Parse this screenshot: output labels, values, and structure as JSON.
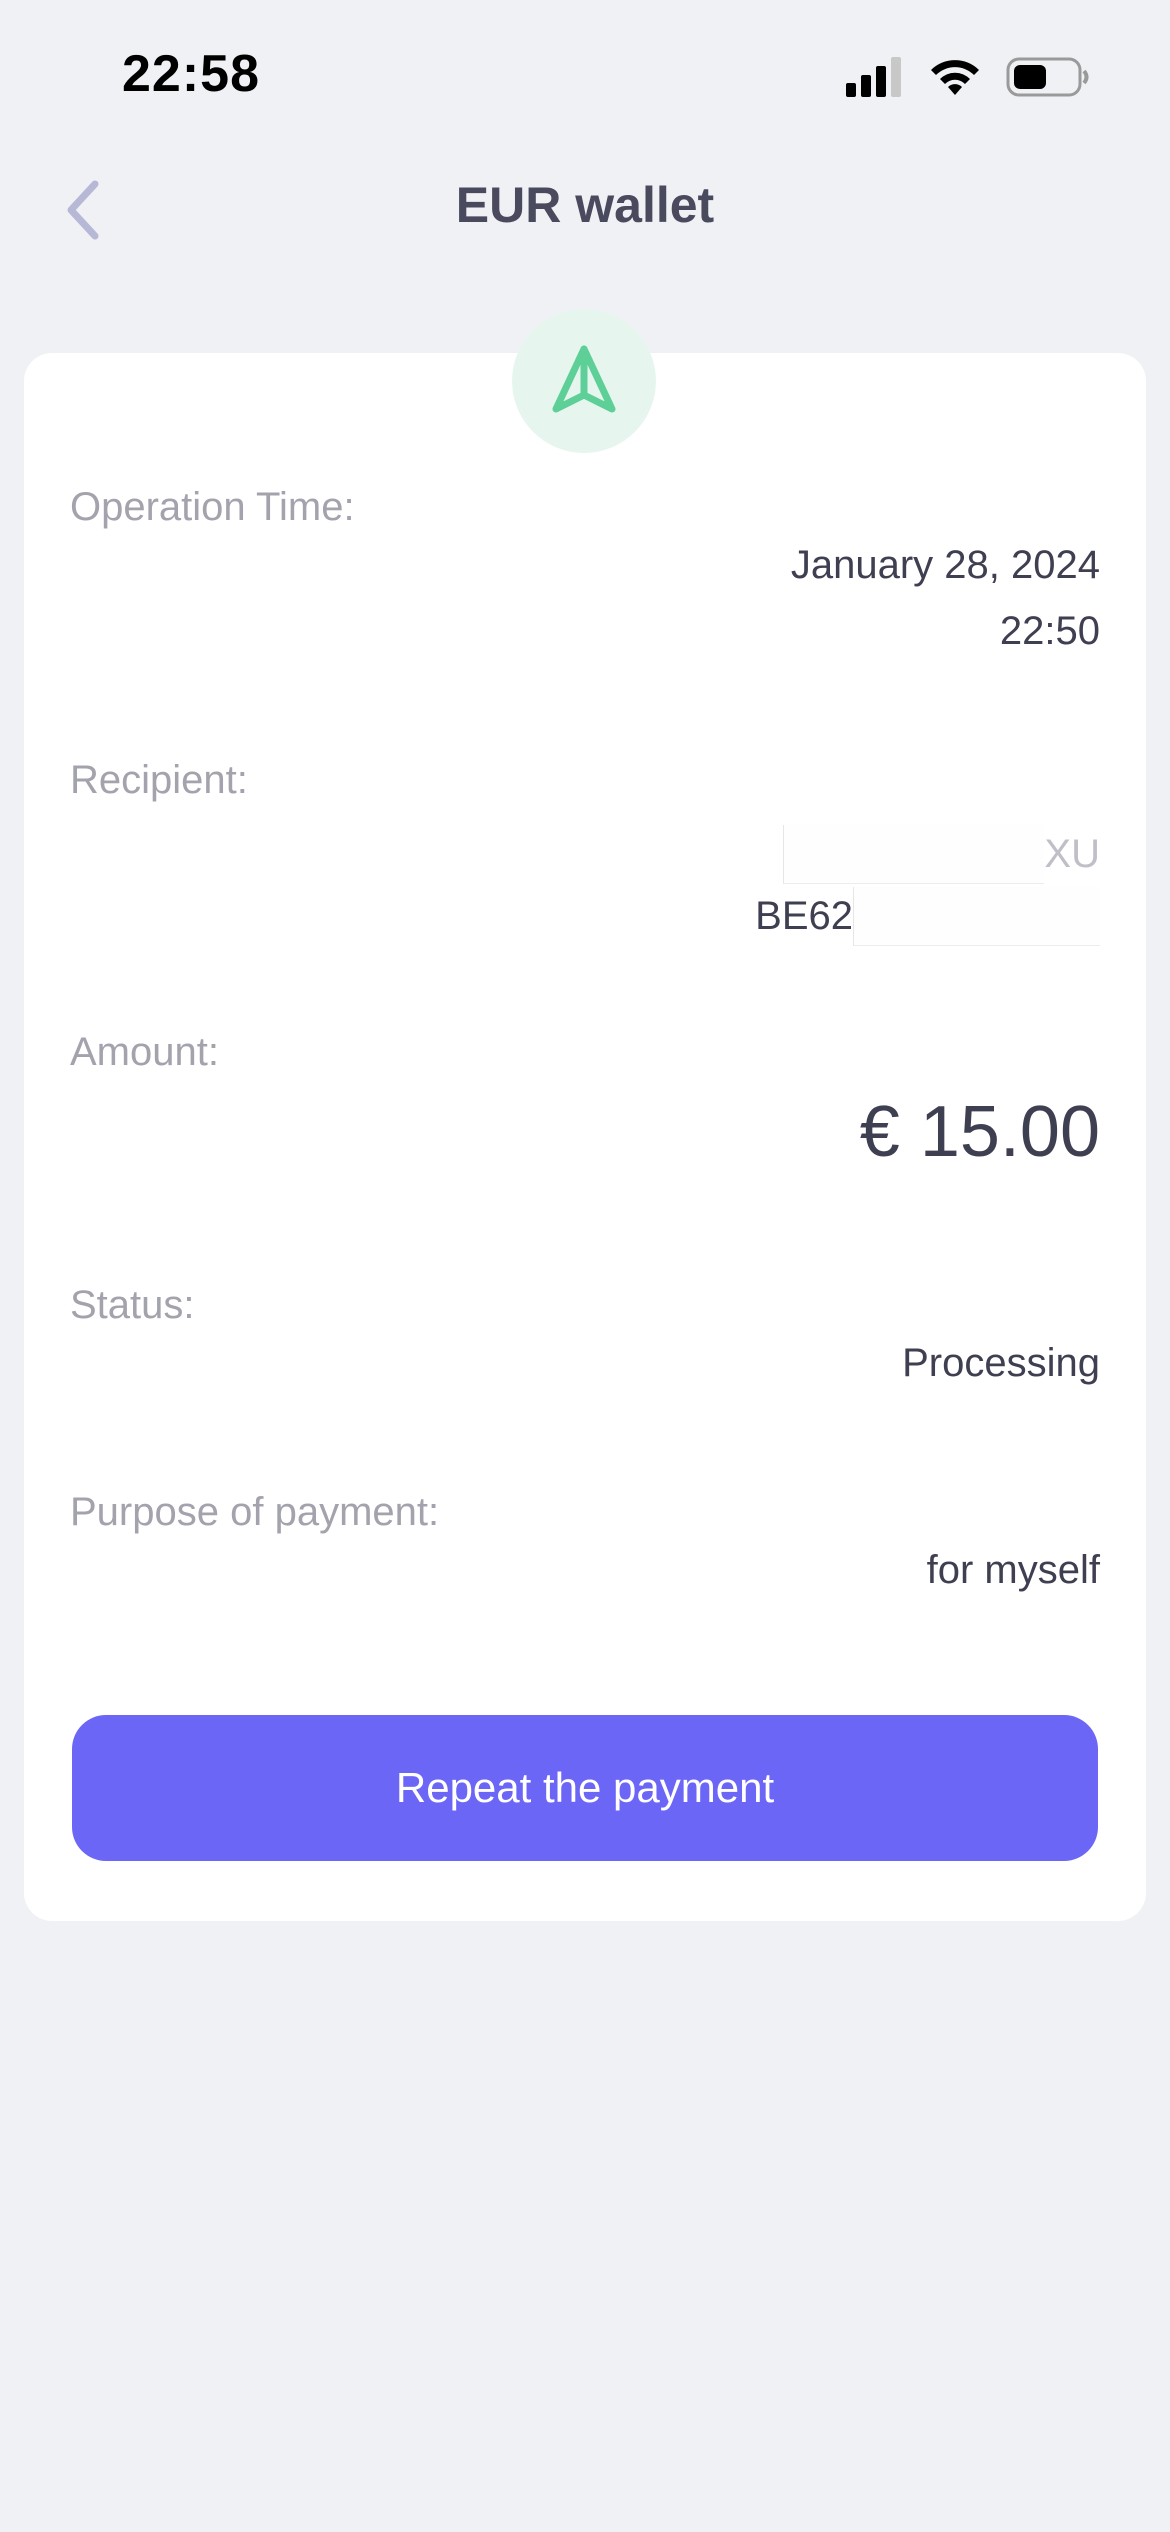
{
  "status_bar": {
    "time": "22:58"
  },
  "header": {
    "title": "EUR wallet"
  },
  "details": {
    "operation_time_label": "Operation Time:",
    "operation_date": "January 28, 2024",
    "operation_time": "22:50",
    "recipient_label": "Recipient:",
    "recipient_line1_suffix": "XU",
    "recipient_iban_prefix": "BE62",
    "amount_label": "Amount:",
    "amount_value": "€ 15.00",
    "status_label": "Status:",
    "status_value": "Processing",
    "purpose_label": "Purpose of payment:",
    "purpose_value": "for myself"
  },
  "actions": {
    "repeat_label": "Repeat the payment"
  },
  "colors": {
    "background": "#f0f1f4",
    "card": "#ffffff",
    "accent": "#6c66f6",
    "icon_green": "#5fcf98",
    "icon_bg": "#e6f6ef"
  },
  "icons": {
    "back": "chevron-left-icon",
    "operation": "send-arrow-icon",
    "signal": "cellular-signal-icon",
    "wifi": "wifi-icon",
    "battery": "battery-icon"
  }
}
